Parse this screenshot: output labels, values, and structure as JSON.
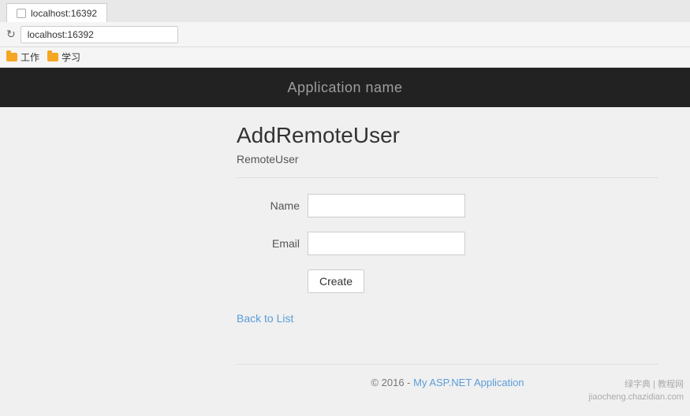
{
  "browser": {
    "tab_title": "localhost:16392",
    "address": "localhost:16392",
    "refresh_icon": "↻",
    "bookmarks": [
      {
        "label": "工作"
      },
      {
        "label": "学习"
      }
    ]
  },
  "navbar": {
    "app_title": "Application name"
  },
  "page": {
    "heading": "AddRemoteUser",
    "subtitle": "RemoteUser",
    "form": {
      "name_label": "Name",
      "name_placeholder": "",
      "email_label": "Email",
      "email_placeholder": "",
      "create_button": "Create"
    },
    "back_link": "Back to List"
  },
  "footer": {
    "copyright": "© 2016 - ",
    "link_text": "My ASP.NET Application"
  },
  "watermark": {
    "line1": "绿字典 | 教程网",
    "line2": "jiaocheng.chazidian.com"
  }
}
